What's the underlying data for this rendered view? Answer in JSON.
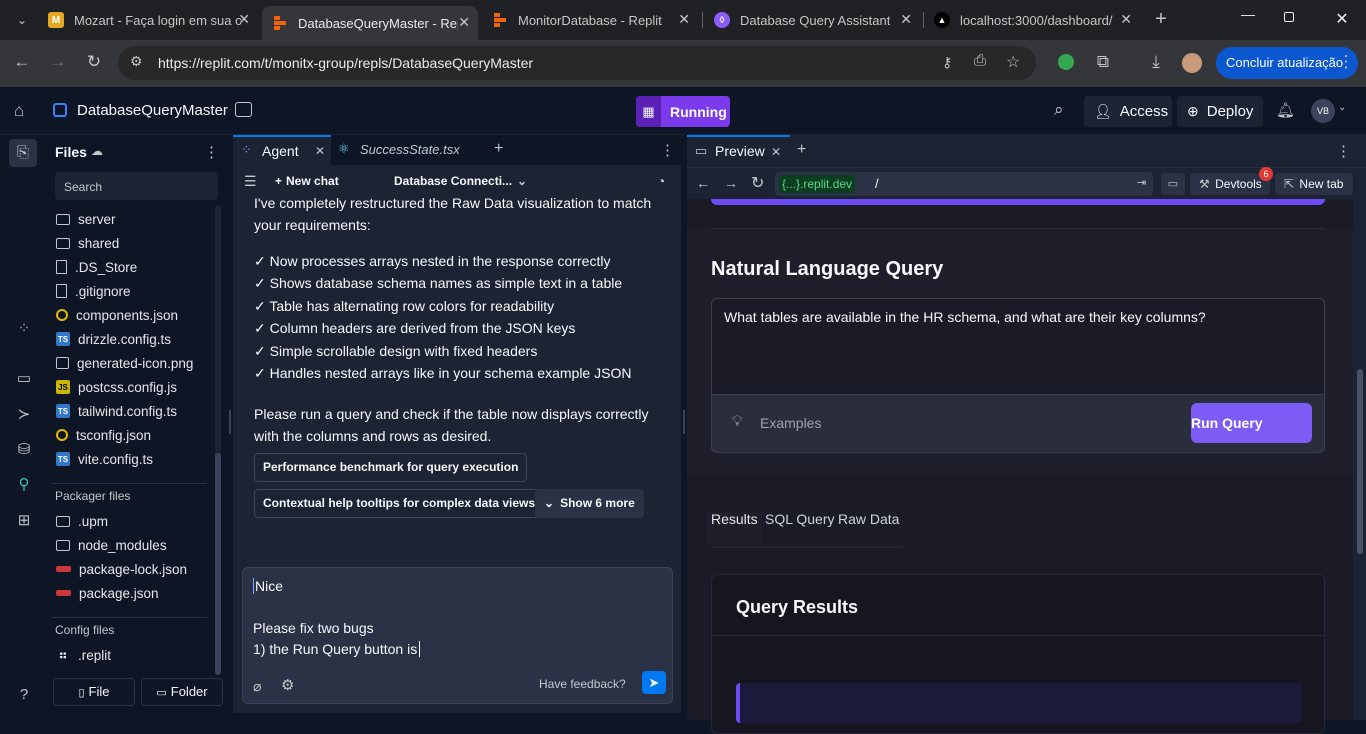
{
  "browser": {
    "tabs": [
      {
        "title": "Mozart - Faça login em sua c",
        "favicon": "M"
      },
      {
        "title": "DatabaseQueryMaster - Repl",
        "favicon": "replit"
      },
      {
        "title": "MonitorDatabase - Replit",
        "favicon": "replit"
      },
      {
        "title": "Database Query Assistant",
        "favicon": "shield"
      },
      {
        "title": "localhost:3000/dashboard/",
        "favicon": "triangle"
      }
    ],
    "url": "https://replit.com/t/monitx-group/repls/DatabaseQueryMaster",
    "update_button": "Concluir atualização"
  },
  "header": {
    "project_name": "DatabaseQueryMaster",
    "status": "Running",
    "access_label": "Access",
    "deploy_label": "Deploy",
    "avatar_initials": "VB"
  },
  "files": {
    "title": "Files",
    "search_placeholder": "Search",
    "items": [
      {
        "name": "server",
        "type": "folder"
      },
      {
        "name": "shared",
        "type": "folder"
      },
      {
        "name": ".DS_Store",
        "type": "doc"
      },
      {
        "name": ".gitignore",
        "type": "doc"
      },
      {
        "name": "components.json",
        "type": "cfg"
      },
      {
        "name": "drizzle.config.ts",
        "type": "ts"
      },
      {
        "name": "generated-icon.png",
        "type": "img"
      },
      {
        "name": "postcss.config.js",
        "type": "js"
      },
      {
        "name": "tailwind.config.ts",
        "type": "ts"
      },
      {
        "name": "tsconfig.json",
        "type": "cfg"
      },
      {
        "name": "vite.config.ts",
        "type": "ts"
      }
    ],
    "packager_title": "Packager files",
    "packager_items": [
      {
        "name": ".upm",
        "type": "folder"
      },
      {
        "name": "node_modules",
        "type": "folder"
      },
      {
        "name": "package-lock.json",
        "type": "npm"
      },
      {
        "name": "package.json",
        "type": "npm"
      }
    ],
    "config_title": "Config files",
    "config_items": [
      {
        "name": ".replit",
        "type": "replit"
      }
    ],
    "file_button": "File",
    "folder_button": "Folder"
  },
  "agent": {
    "tab_agent": "Agent",
    "tab_file": "SuccessState.tsx",
    "new_chat": "New chat",
    "chat_title": "Database Connecti...",
    "intro_line1": "I've completely restructured the Raw Data visualization to match",
    "intro_line2": "your requirements:",
    "checks": [
      "✓ Now processes arrays nested in the response correctly",
      "✓ Shows database schema names as simple text in a table",
      "✓ Table has alternating row colors for readability",
      "✓ Column headers are derived from the JSON keys",
      "✓ Simple scrollable design with fixed headers",
      "✓ Handles nested arrays like in your schema example JSON"
    ],
    "outro_line1": "Please run a query and check if the table now displays correctly",
    "outro_line2": "with the columns and rows as desired.",
    "suggestions": [
      "Performance benchmark for query execution",
      "Contextual help tooltips for complex data views"
    ],
    "show_more": "Show 6 more",
    "input_lines": [
      "Nice",
      "",
      "Please fix two bugs",
      "1) the Run Query button is"
    ],
    "feedback": "Have feedback?"
  },
  "preview": {
    "tab_label": "Preview",
    "domain_badge": "{...}.replit.dev",
    "path": "/",
    "devtools_label": "Devtools",
    "devtools_count": "6",
    "new_tab_label": "New tab",
    "site": {
      "nl_title": "Natural Language Query",
      "query_text": "What tables are available in the HR schema, and what are their key columns?",
      "examples_label": "Examples",
      "run_button": "Run Query",
      "result_tabs": [
        "Results",
        "SQL Query",
        "Raw Data"
      ],
      "results_title": "Query Results"
    }
  },
  "colors": {
    "accent": "#7c3aed",
    "run_button": "#7c5cf5"
  }
}
